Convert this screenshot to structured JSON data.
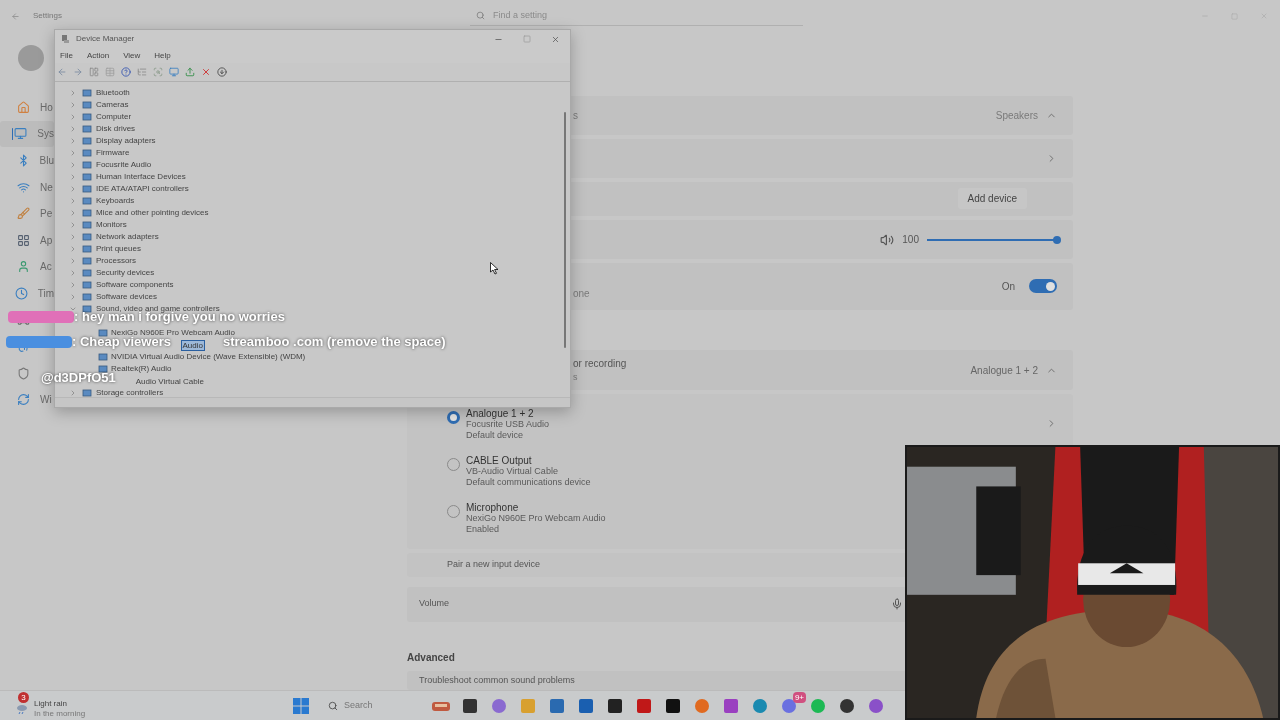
{
  "settings_window": {
    "title": "Settings",
    "search": {
      "placeholder": "Find a setting"
    }
  },
  "sidebar": {
    "items": [
      {
        "kind": "home",
        "label": "Ho",
        "selected": false
      },
      {
        "kind": "system",
        "label": "Sys",
        "selected": true
      },
      {
        "kind": "bluetooth",
        "label": "Blu",
        "selected": false
      },
      {
        "kind": "network",
        "label": "Ne",
        "selected": false
      },
      {
        "kind": "personalization",
        "label": "Pe",
        "selected": false
      },
      {
        "kind": "apps",
        "label": "Ap",
        "selected": false
      },
      {
        "kind": "accounts",
        "label": "Ac",
        "selected": false
      },
      {
        "kind": "time",
        "label": "Tim",
        "selected": false
      },
      {
        "kind": "gaming",
        "selected": false
      },
      {
        "kind": "accessibility",
        "selected": false
      },
      {
        "kind": "privacy",
        "selected": false
      },
      {
        "kind": "update",
        "label": "Wi",
        "selected": false
      }
    ]
  },
  "sound": {
    "rows": [
      {
        "kind": "dropdown",
        "fragment": "s",
        "value": "Speakers",
        "expanded": true
      },
      {
        "kind": "link"
      },
      {
        "kind": "button",
        "button": "Add device"
      },
      {
        "kind": "volume",
        "value": "100",
        "level": 1.0
      },
      {
        "kind": "toggle",
        "fragment": "one",
        "state": "On",
        "on": true
      }
    ],
    "input_header": {
      "fragment": "or recording",
      "fragment_2": "s",
      "value": "Analogue 1 + 2",
      "expanded": true
    },
    "input_devices": [
      {
        "name": "Analogue 1 + 2",
        "detail": "Focusrite USB Audio",
        "status": "Default device",
        "selected": true
      },
      {
        "name": "CABLE Output",
        "detail": "VB-Audio Virtual Cable",
        "status": "Default communications device",
        "selected": false
      },
      {
        "name": "Microphone",
        "detail": "NexiGo N960E Pro Webcam Audio",
        "status": "Enabled",
        "selected": false
      }
    ],
    "pair_input": "Pair a new input device",
    "input_volume": {
      "label": "Volume"
    },
    "advanced": {
      "heading": "Advanced",
      "first_row": "Troubleshoot common sound problems"
    }
  },
  "device_manager": {
    "title": "Device Manager",
    "menu": [
      "File",
      "Action",
      "View",
      "Help"
    ],
    "tree": [
      {
        "label": "Bluetooth",
        "expanded": false
      },
      {
        "label": "Cameras",
        "expanded": false
      },
      {
        "label": "Computer",
        "expanded": false
      },
      {
        "label": "Disk drives",
        "expanded": false
      },
      {
        "label": "Display adapters",
        "expanded": false
      },
      {
        "label": "Firmware",
        "expanded": false
      },
      {
        "label": "Focusrite Audio",
        "expanded": false
      },
      {
        "label": "Human Interface Devices",
        "expanded": false
      },
      {
        "label": "IDE ATA/ATAPI controllers",
        "expanded": false
      },
      {
        "label": "Keyboards",
        "expanded": false
      },
      {
        "label": "Mice and other pointing devices",
        "expanded": false
      },
      {
        "label": "Monitors",
        "expanded": false
      },
      {
        "label": "Network adapters",
        "expanded": false
      },
      {
        "label": "Print queues",
        "expanded": false
      },
      {
        "label": "Processors",
        "expanded": false
      },
      {
        "label": "Security devices",
        "expanded": false
      },
      {
        "label": "Software components",
        "expanded": false
      },
      {
        "label": "Software devices",
        "expanded": false
      },
      {
        "label": "Sound, video and game controllers",
        "expanded": true,
        "children": [
          {
            "label": "NexiGo N960E Pro Webcam Audio",
            "selected": false
          },
          {
            "label": "Audio",
            "selected": true,
            "partly_hidden": true
          },
          {
            "label": "NVIDIA Virtual Audio Device (Wave Extensible) (WDM)",
            "selected": false
          },
          {
            "label": "Realtek(R) Audio",
            "selected": false
          },
          {
            "label": "Audio Virtual Cable",
            "selected": false,
            "partly_hidden": true
          }
        ]
      },
      {
        "label": "Storage controllers",
        "expanded": false
      }
    ]
  },
  "chat": [
    {
      "color": "#e070b8",
      "parts": [
        ": hey man i forgive you no worries"
      ]
    },
    {
      "color": "#4a8fe0",
      "parts": [
        ": Cheap viewers",
        "streamboo .com (remove the space)"
      ]
    },
    {
      "parts": [
        "@d3DPfO51"
      ]
    }
  ],
  "taskbar": {
    "weather": {
      "badge": "3",
      "title": "Light rain",
      "subtitle": "In the morning"
    },
    "search": {
      "placeholder": "Search"
    },
    "apps": [
      {
        "kind": "widget"
      },
      {
        "kind": "terminal"
      },
      {
        "kind": "copilot"
      },
      {
        "kind": "files"
      },
      {
        "kind": "store"
      },
      {
        "kind": "outlook"
      },
      {
        "kind": "amazon"
      },
      {
        "kind": "netflix"
      },
      {
        "kind": "x"
      },
      {
        "kind": "firefox"
      },
      {
        "kind": "game"
      },
      {
        "kind": "edge"
      },
      {
        "kind": "discord",
        "badge": "9+"
      },
      {
        "kind": "spotify"
      },
      {
        "kind": "camera"
      },
      {
        "kind": "triangle"
      }
    ]
  }
}
